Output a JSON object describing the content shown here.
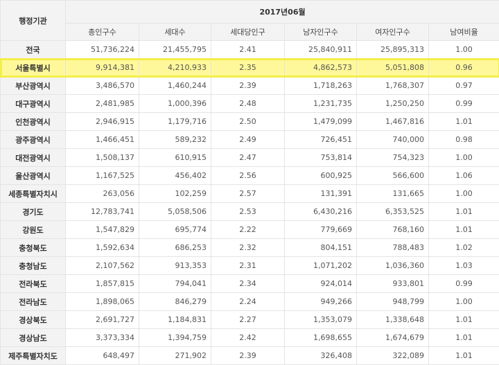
{
  "header": {
    "region_label": "행정기관",
    "period": "2017년06월",
    "columns": [
      "총인구수",
      "세대수",
      "세대당인구",
      "남자인구수",
      "여자인구수",
      "남여비율"
    ]
  },
  "rows": [
    {
      "region": "전국",
      "pop": "51,736,224",
      "hh": "21,455,795",
      "per": "2.41",
      "male": "25,840,911",
      "female": "25,895,313",
      "ratio": "1.00"
    },
    {
      "region": "서울특별시",
      "pop": "9,914,381",
      "hh": "4,210,933",
      "per": "2.35",
      "male": "4,862,573",
      "female": "5,051,808",
      "ratio": "0.96"
    },
    {
      "region": "부산광역시",
      "pop": "3,486,570",
      "hh": "1,460,244",
      "per": "2.39",
      "male": "1,718,263",
      "female": "1,768,307",
      "ratio": "0.97"
    },
    {
      "region": "대구광역시",
      "pop": "2,481,985",
      "hh": "1,000,396",
      "per": "2.48",
      "male": "1,231,735",
      "female": "1,250,250",
      "ratio": "0.99"
    },
    {
      "region": "인천광역시",
      "pop": "2,946,915",
      "hh": "1,179,716",
      "per": "2.50",
      "male": "1,479,099",
      "female": "1,467,816",
      "ratio": "1.01"
    },
    {
      "region": "광주광역시",
      "pop": "1,466,451",
      "hh": "589,232",
      "per": "2.49",
      "male": "726,451",
      "female": "740,000",
      "ratio": "0.98"
    },
    {
      "region": "대전광역시",
      "pop": "1,508,137",
      "hh": "610,915",
      "per": "2.47",
      "male": "753,814",
      "female": "754,323",
      "ratio": "1.00"
    },
    {
      "region": "울산광역시",
      "pop": "1,167,525",
      "hh": "456,402",
      "per": "2.56",
      "male": "600,925",
      "female": "566,600",
      "ratio": "1.06"
    },
    {
      "region": "세종특별자치시",
      "pop": "263,056",
      "hh": "102,259",
      "per": "2.57",
      "male": "131,391",
      "female": "131,665",
      "ratio": "1.00"
    },
    {
      "region": "경기도",
      "pop": "12,783,741",
      "hh": "5,058,506",
      "per": "2.53",
      "male": "6,430,216",
      "female": "6,353,525",
      "ratio": "1.01"
    },
    {
      "region": "강원도",
      "pop": "1,547,829",
      "hh": "695,774",
      "per": "2.22",
      "male": "779,669",
      "female": "768,160",
      "ratio": "1.01"
    },
    {
      "region": "충청북도",
      "pop": "1,592,634",
      "hh": "686,253",
      "per": "2.32",
      "male": "804,151",
      "female": "788,483",
      "ratio": "1.02"
    },
    {
      "region": "충청남도",
      "pop": "2,107,562",
      "hh": "913,353",
      "per": "2.31",
      "male": "1,071,202",
      "female": "1,036,360",
      "ratio": "1.03"
    },
    {
      "region": "전라북도",
      "pop": "1,857,815",
      "hh": "794,041",
      "per": "2.34",
      "male": "924,014",
      "female": "933,801",
      "ratio": "0.99"
    },
    {
      "region": "전라남도",
      "pop": "1,898,065",
      "hh": "846,279",
      "per": "2.24",
      "male": "949,266",
      "female": "948,799",
      "ratio": "1.00"
    },
    {
      "region": "경상북도",
      "pop": "2,691,727",
      "hh": "1,184,831",
      "per": "2.27",
      "male": "1,353,079",
      "female": "1,338,648",
      "ratio": "1.01"
    },
    {
      "region": "경상남도",
      "pop": "3,373,334",
      "hh": "1,394,759",
      "per": "2.42",
      "male": "1,698,655",
      "female": "1,674,679",
      "ratio": "1.01"
    },
    {
      "region": "제주특별자치도",
      "pop": "648,497",
      "hh": "271,902",
      "per": "2.39",
      "male": "326,408",
      "female": "322,089",
      "ratio": "1.01"
    }
  ],
  "highlight_row_index": 1,
  "highlight_color": "#fff89a"
}
